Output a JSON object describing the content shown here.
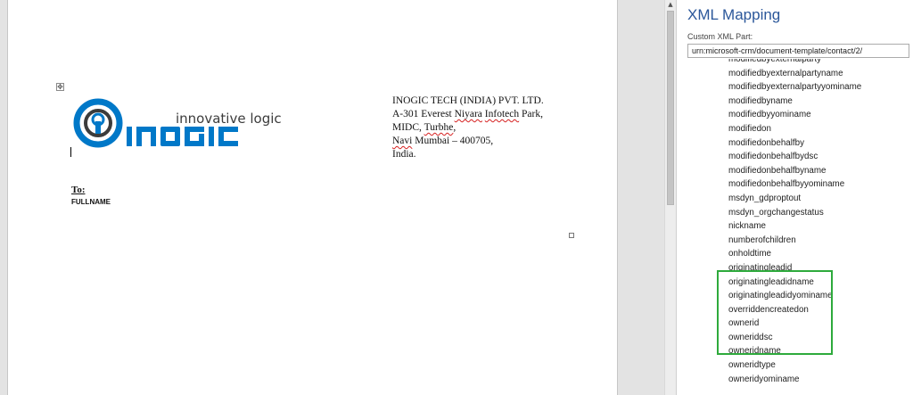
{
  "document": {
    "company_lines": [
      "INOGIC TECH (INDIA) PVT. LTD.",
      "A-301 Everest Niyara Infotech Park,",
      "MIDC, Turbhe,",
      "Navi Mumbai – 400705,",
      "India."
    ],
    "to_label": "To:",
    "fullname_field": "FULLNAME",
    "logo": {
      "tagline": "innovative logic",
      "wordmark": "INOGIC",
      "colors": {
        "blue": "#0078c8",
        "gray": "#3c3c3c"
      }
    }
  },
  "xml_mapping": {
    "title": "XML Mapping",
    "custom_xml_part_label": "Custom XML Part:",
    "custom_xml_part_value": "urn:microsoft-crm/document-template/contact/2/",
    "nodes": [
      "modifiedbyexternalparty",
      "modifiedbyexternalpartyname",
      "modifiedbyexternalpartyyominame",
      "modifiedbyname",
      "modifiedbyyominame",
      "modifiedon",
      "modifiedonbehalfby",
      "modifiedonbehalfbydsc",
      "modifiedonbehalfbyname",
      "modifiedonbehalfbyyominame",
      "msdyn_gdproptout",
      "msdyn_orgchangestatus",
      "nickname",
      "numberofchildren",
      "onholdtime",
      "originatingleadid",
      "originatingleadidname",
      "originatingleadidyominame",
      "overriddencreatedon",
      "ownerid",
      "owneriddsc",
      "owneridname",
      "owneridtype",
      "owneridyominame"
    ],
    "highlight_color": "#2eaa3c",
    "title_color": "#2b579a"
  }
}
